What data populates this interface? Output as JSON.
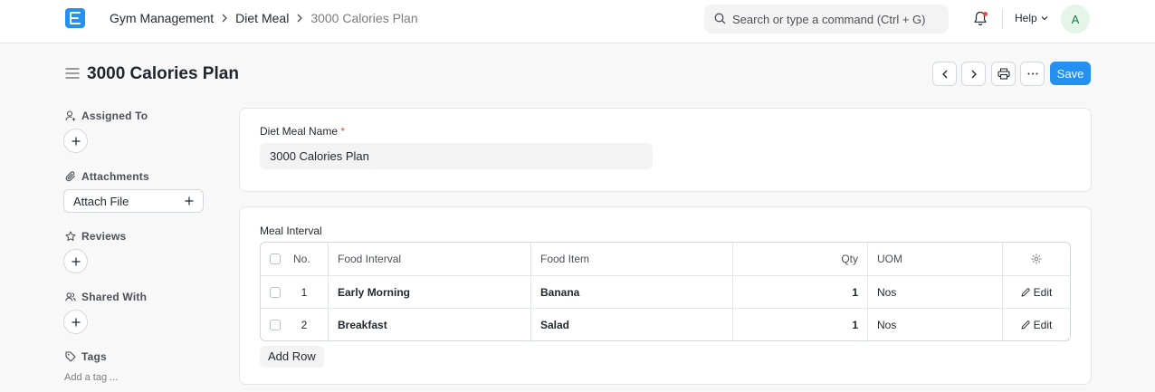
{
  "navbar": {
    "breadcrumbs": [
      "Gym Management",
      "Diet Meal",
      "3000 Calories Plan"
    ],
    "search_placeholder": "Search or type a command (Ctrl + G)",
    "help_label": "Help",
    "avatar_initial": "A"
  },
  "page": {
    "title": "3000 Calories Plan",
    "save_label": "Save"
  },
  "sidebar": {
    "assigned_to": "Assigned To",
    "attachments": "Attachments",
    "attach_file": "Attach File",
    "reviews": "Reviews",
    "shared_with": "Shared With",
    "tags": "Tags",
    "add_tag": "Add a tag ..."
  },
  "form": {
    "diet_meal_name_label": "Diet Meal Name",
    "required_mark": "*",
    "diet_meal_name_value": "3000 Calories Plan"
  },
  "meal_interval": {
    "section_label": "Meal Interval",
    "columns": {
      "no": "No.",
      "food_interval": "Food Interval",
      "food_item": "Food Item",
      "qty": "Qty",
      "uom": "UOM"
    },
    "rows": [
      {
        "no": "1",
        "food_interval": "Early Morning",
        "food_item": "Banana",
        "qty": "1",
        "uom": "Nos",
        "edit": "Edit"
      },
      {
        "no": "2",
        "food_interval": "Breakfast",
        "food_item": "Salad",
        "qty": "1",
        "uom": "Nos",
        "edit": "Edit"
      }
    ],
    "add_row_label": "Add Row"
  },
  "colors": {
    "primary": "#2490ef",
    "required": "#e24c4c",
    "avatar_bg": "#e4f5e9",
    "avatar_fg": "#16794c"
  }
}
